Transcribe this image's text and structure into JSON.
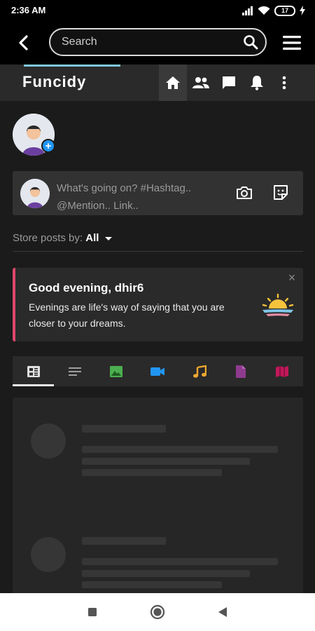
{
  "status_bar": {
    "time": "2:36 AM",
    "battery": "17",
    "icons": [
      "signal-icon",
      "wifi-icon",
      "battery-icon",
      "charging-icon"
    ]
  },
  "search": {
    "placeholder": "Search",
    "icons": [
      "back-arrow-icon",
      "search-icon",
      "hamburger-menu-icon"
    ]
  },
  "header": {
    "brand": "Funcidy",
    "nav": [
      {
        "name": "home",
        "icon": "home-icon",
        "active": true
      },
      {
        "name": "friends",
        "icon": "people-icon",
        "active": false
      },
      {
        "name": "messages",
        "icon": "chat-icon",
        "active": false
      },
      {
        "name": "notifications",
        "icon": "bell-icon",
        "active": false
      },
      {
        "name": "more",
        "icon": "more-vert-icon",
        "active": false
      }
    ]
  },
  "composer": {
    "placeholder_line1": "What's going on? #Hashtag..",
    "placeholder_line2": "@Mention.. Link..",
    "icons": [
      "camera-icon",
      "sticker-icon"
    ]
  },
  "sort": {
    "label": "Store posts by:",
    "value": "All"
  },
  "greeting": {
    "title": "Good evening, dhir6",
    "message": "Evenings are life's way of saying that you are closer to your dreams.",
    "close": "×",
    "icon": "sunset-icon",
    "accent": "#e0476a"
  },
  "post_tabs": [
    {
      "name": "all",
      "icon": "feed-icon",
      "color": "#e0e0e0",
      "active": true
    },
    {
      "name": "text",
      "icon": "text-lines-icon",
      "color": "#9e9e9e",
      "active": false
    },
    {
      "name": "photos",
      "icon": "image-icon",
      "color": "#4caf50",
      "active": false
    },
    {
      "name": "videos",
      "icon": "video-camera-icon",
      "color": "#2196f3",
      "active": false
    },
    {
      "name": "music",
      "icon": "music-note-icon",
      "color": "#f0a830",
      "active": false
    },
    {
      "name": "files",
      "icon": "file-icon",
      "color": "#8e3b8e",
      "active": false
    },
    {
      "name": "maps",
      "icon": "map-icon",
      "color": "#c2185b",
      "active": false
    }
  ],
  "system_nav": [
    "recents-square-icon",
    "home-circle-icon",
    "back-triangle-icon"
  ]
}
